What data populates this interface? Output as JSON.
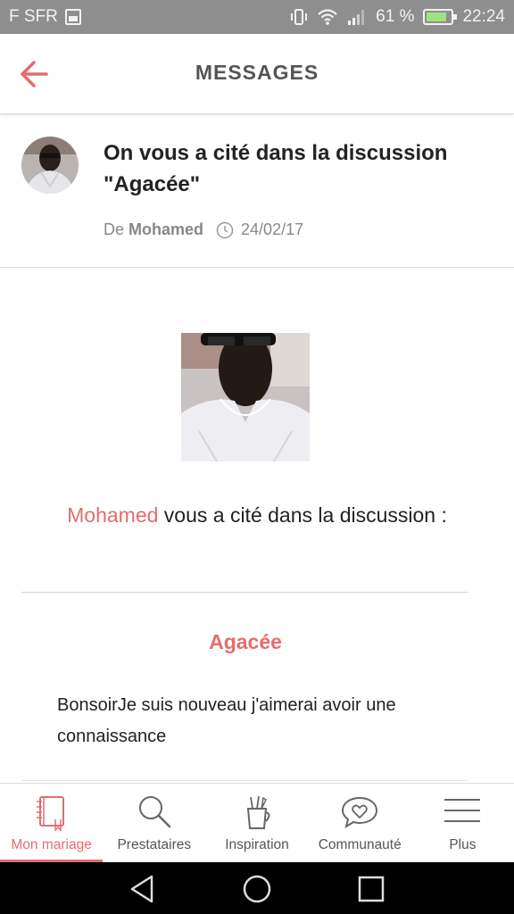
{
  "status_bar": {
    "carrier": "F SFR",
    "battery_percent": "61 %",
    "time": "22:24"
  },
  "app_bar": {
    "title": "MESSAGES",
    "back_icon": "arrow-left-icon"
  },
  "notification": {
    "title": "On vous a cité dans la discussion \"Agacée\"",
    "from_prefix": "De",
    "author": "Mohamed",
    "date": "24/02/17"
  },
  "body": {
    "cited_by": "Mohamed",
    "cite_text": "vous a cité dans la discussion :",
    "discussion_title": "Agacée",
    "message": "BonsoirJe suis nouveau j'aimerai avoir une connaissance"
  },
  "bottom_nav": {
    "items": [
      {
        "label": "Mon mariage",
        "icon": "planner-book-icon",
        "active": true
      },
      {
        "label": "Prestataires",
        "icon": "search-icon",
        "active": false
      },
      {
        "label": "Inspiration",
        "icon": "inspiration-cup-icon",
        "active": false
      },
      {
        "label": "Communauté",
        "icon": "community-heart-bubble-icon",
        "active": false
      },
      {
        "label": "Plus",
        "icon": "menu-icon",
        "active": false
      }
    ]
  },
  "colors": {
    "accent": "#e46d6d",
    "status_bar": "#8e8e8e",
    "text": "#222222",
    "muted": "#888888"
  }
}
